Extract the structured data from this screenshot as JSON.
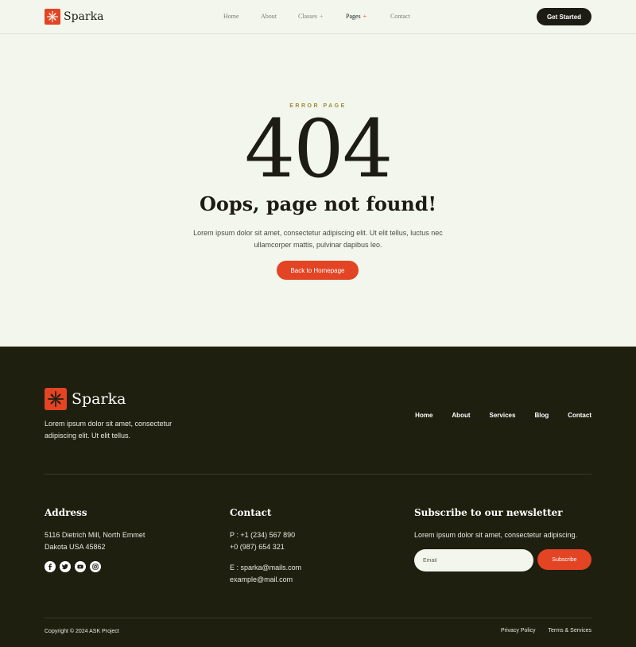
{
  "header": {
    "brand": "Sparka",
    "nav": [
      {
        "label": "Home",
        "plus": ""
      },
      {
        "label": "About",
        "plus": ""
      },
      {
        "label": "Classes",
        "plus": "+"
      },
      {
        "label": "Pages",
        "plus": "+"
      },
      {
        "label": "Contact",
        "plus": ""
      }
    ],
    "cta": "Get Started"
  },
  "hero": {
    "eyebrow": "ERROR PAGE",
    "code": "404",
    "title": "Oops, page not found!",
    "description": "Lorem ipsum dolor sit amet, consectetur adipiscing elit. Ut elit tellus, luctus nec ullamcorper mattis, pulvinar dapibus leo.",
    "button": "Back to Homepage"
  },
  "footer": {
    "brand": "Sparka",
    "about": "Lorem ipsum dolor sit amet, consectetur adipiscing elit. Ut elit tellus.",
    "nav": [
      "Home",
      "About",
      "Services",
      "Blog",
      "Contact"
    ],
    "address": {
      "title": "Address",
      "line1": "5116 Dietrich Mill, North Emmet",
      "line2": "Dakota USA 45862"
    },
    "contact": {
      "title": "Contact",
      "phone1": "P : +1 (234) 567 890",
      "phone2": "+0 (987) 654 321",
      "email1": "E : sparka@mails.com",
      "email2": "example@mail.com"
    },
    "newsletter": {
      "title": "Subscribe to our newsletter",
      "text": "Lorem ipsum dolor sit amet, consectetur adipiscing.",
      "placeholder": "Email",
      "button": "Subscribe"
    },
    "socials": [
      "facebook-icon",
      "twitter-icon",
      "youtube-icon",
      "instagram-icon"
    ],
    "copyright": "Copyright © 2024 ASK Project",
    "legal": [
      "Privacy Policy",
      "Terms & Services"
    ]
  },
  "colors": {
    "accent": "#e24424",
    "dark": "#1c1c14",
    "footer_bg": "#1f1f10",
    "page_bg": "#f3f6ec",
    "eyebrow": "#9a8a3a"
  }
}
